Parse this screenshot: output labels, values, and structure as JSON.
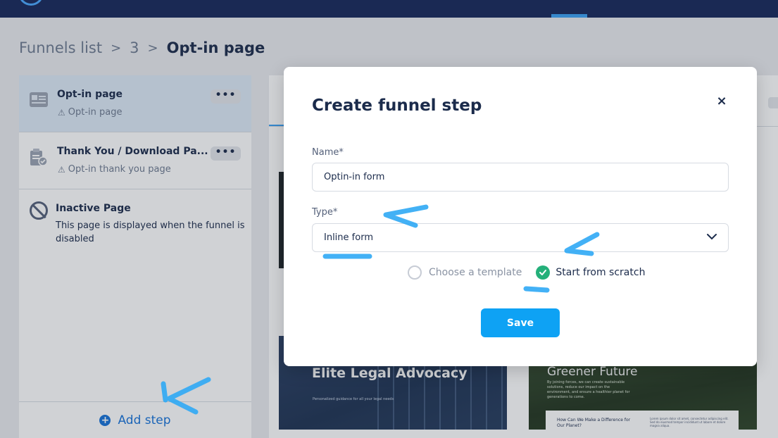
{
  "breadcrumb": {
    "items": [
      "Funnels list",
      "3"
    ],
    "current": "Opt-in page",
    "separator": ">"
  },
  "sidebar": {
    "steps": [
      {
        "title": "Opt-in page",
        "subtitle": "Opt-in page",
        "active": true
      },
      {
        "title": "Thank You / Download Pa...",
        "subtitle": "Opt-in thank you page",
        "active": false
      }
    ],
    "inactive": {
      "title": "Inactive Page",
      "description": "This page is displayed when the funnel is disabled"
    },
    "add_step_label": "Add step",
    "more_glyph": "•••"
  },
  "cards": {
    "legal": {
      "title": "Elite Legal Advocacy",
      "tagline": "Personalized guidance for all your legal needs"
    },
    "green": {
      "title": "Greener Future",
      "blurb": "By joining forces, we can create sustainable solutions, reduce our impact on the environment, and ensure a healthier planet for generations to come.",
      "panel_heading": "How Can We Make a Difference for Our Planet?",
      "panel_text": "Lorem ipsum dolor sit amet, consectetur adipiscing elit. Sed do eiusmod tempor incididunt ut labore et dolore magna aliqua."
    }
  },
  "modal": {
    "title": "Create funnel step",
    "close_glyph": "×",
    "name": {
      "label": "Name",
      "required_mark": "*",
      "value": "Optin-in form"
    },
    "type": {
      "label": "Type",
      "required_mark": "*",
      "value": "Inline form"
    },
    "options": {
      "template_label": "Choose a template",
      "scratch_label": "Start from scratch",
      "selected": "scratch"
    },
    "save_label": "Save"
  },
  "colors": {
    "topbar": "#16275a",
    "primary_button": "#0ea2f4",
    "link_blue": "#1672d9",
    "check_green": "#24b07a",
    "annotation_blue": "#2fa9f5"
  },
  "icons": {
    "close": "close-icon",
    "chevron": "chevron-down-icon",
    "check": "check-icon",
    "add": "plus-circle-icon",
    "warning": "warning-icon",
    "disabled": "disabled-icon"
  }
}
